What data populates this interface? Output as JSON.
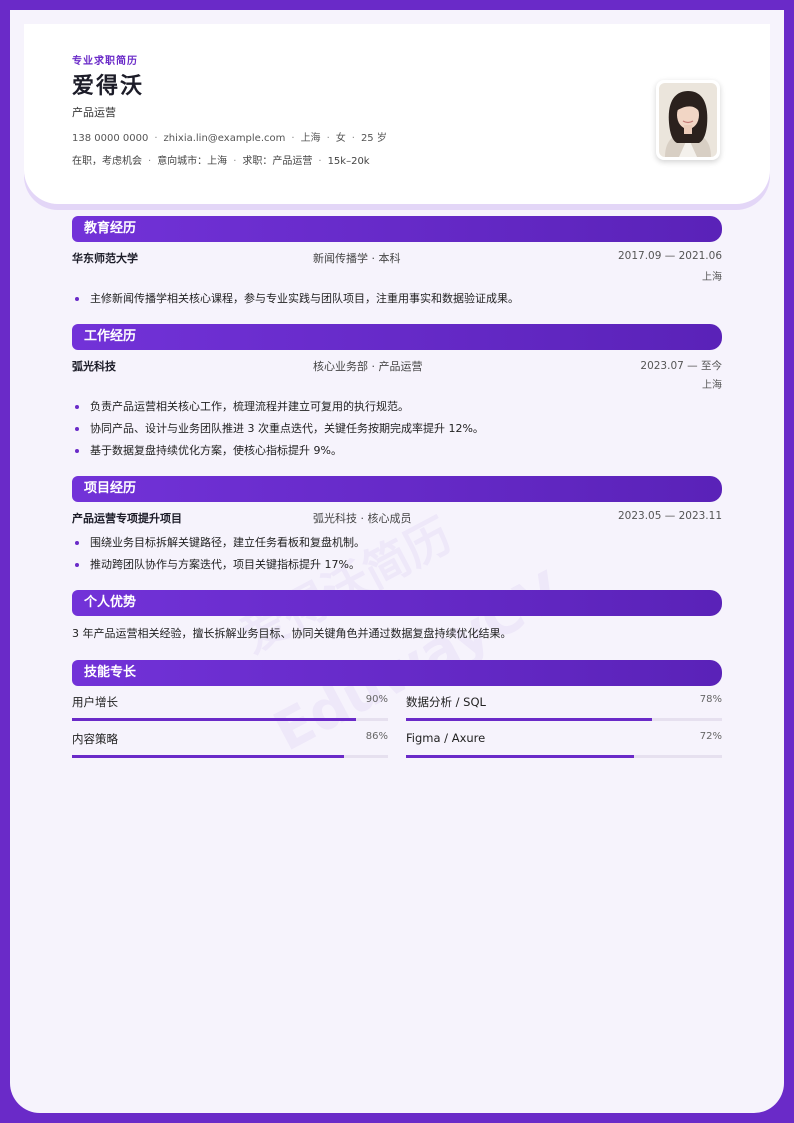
{
  "header": {
    "tag": "专业求职简历",
    "name": "爱得沃",
    "role": "产品运营",
    "contact": {
      "phone": "138 0000 0000",
      "email": "zhixia.lin@example.com",
      "city": "上海",
      "gender": "女",
      "age": "25 岁"
    },
    "meta": {
      "status": "在职，考虑机会",
      "target_city": "意向城市：上海",
      "target_role": "求职：产品运营",
      "salary": "15k–20k"
    }
  },
  "sections": {
    "education": {
      "title": "教育经历",
      "school": "华东师范大学",
      "major": "新闻传播学 · 本科",
      "date": "2017.09 — 2021.06",
      "location": "上海",
      "bullets": [
        "主修新闻传播学相关核心课程，参与专业实践与团队项目，注重用事实和数据验证成果。"
      ]
    },
    "work": {
      "title": "工作经历",
      "company": "弧光科技",
      "dept": "核心业务部 · 产品运营",
      "date": "2023.07 — 至今",
      "location": "上海",
      "bullets": [
        "负责产品运营相关核心工作，梳理流程并建立可复用的执行规范。",
        "协同产品、设计与业务团队推进 3 次重点迭代，关键任务按期完成率提升 12%。",
        "基于数据复盘持续优化方案，使核心指标提升 9%。"
      ]
    },
    "project": {
      "title": "项目经历",
      "name": "产品运营专项提升项目",
      "role": "弧光科技 · 核心成员",
      "date": "2023.05 — 2023.11",
      "bullets": [
        "围绕业务目标拆解关键路径，建立任务看板和复盘机制。",
        "推动跨团队协作与方案迭代，项目关键指标提升 17%。"
      ]
    },
    "strengths": {
      "title": "个人优势",
      "text": "3 年产品运营相关经验，擅长拆解业务目标、协同关键角色并通过数据复盘持续优化结果。"
    },
    "skills": {
      "title": "技能专长",
      "items": [
        {
          "name": "用户增长",
          "pct": "90%",
          "level": 0.9
        },
        {
          "name": "数据分析 / SQL",
          "pct": "78%",
          "level": 0.78
        },
        {
          "name": "内容策略",
          "pct": "86%",
          "level": 0.86
        },
        {
          "name": "Figma / Axure",
          "pct": "72%",
          "level": 0.72
        }
      ]
    }
  },
  "watermark": {
    "line1": "爱得沃简历",
    "line2": "EduwayCV"
  },
  "colors": {
    "accent": "#6a2ac8",
    "background": "#f6f3fc"
  }
}
